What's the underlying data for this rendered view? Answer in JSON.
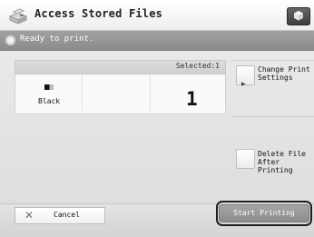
{
  "title_bar": {
    "title": "Access Stored Files"
  },
  "status_bar": {
    "message": "Ready to print."
  },
  "print_panel": {
    "selected_label": "Selected:1",
    "color_mode": "Black",
    "copies": "1"
  },
  "side_menu": {
    "change_print_settings": "Change Print\nSettings",
    "delete_file_after_printing": "Delete File\nAfter Printing"
  },
  "footer": {
    "cancel_label": "Cancel",
    "start_label": "Start Printing"
  },
  "icons": {
    "title": "multifunction-printer-icon",
    "corner": "cube-icon",
    "status": "ready-status-icon",
    "cancel": "x-icon"
  },
  "colors": {
    "status_bar": "#8f9193",
    "start_button": "#9a9a9a",
    "panel_bg": "#fafafa"
  }
}
